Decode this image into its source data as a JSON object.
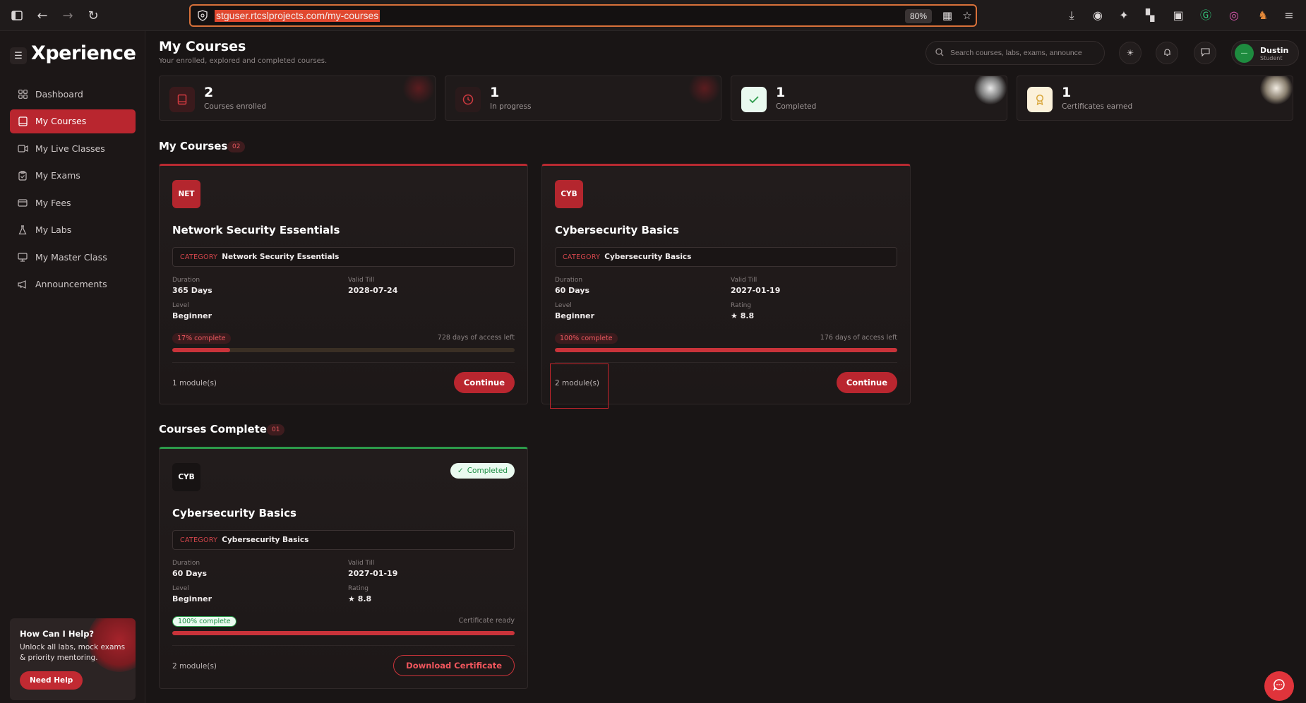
{
  "browser": {
    "url": "stguser.rtcslprojects.com/my-courses",
    "zoom": "80%"
  },
  "sidebar": {
    "logo": "Xperience",
    "items": [
      {
        "label": "Dashboard",
        "icon": "grid-icon"
      },
      {
        "label": "My Courses",
        "icon": "book-icon",
        "active": true
      },
      {
        "label": "My Live Classes",
        "icon": "video-icon"
      },
      {
        "label": "My Exams",
        "icon": "clipboard-icon"
      },
      {
        "label": "My Fees",
        "icon": "card-icon"
      },
      {
        "label": "My Labs",
        "icon": "flask-icon"
      },
      {
        "label": "My Master Class",
        "icon": "monitor-icon"
      },
      {
        "label": "Announcements",
        "icon": "megaphone-icon"
      }
    ],
    "help": {
      "title": "How Can I Help?",
      "desc": "Unlock all labs, mock exams & priority mentoring.",
      "button": "Need Help"
    }
  },
  "header": {
    "title": "My Courses",
    "subtitle": "Your enrolled, explored and completed courses.",
    "search_placeholder": "Search courses, labs, exams, announce",
    "user": {
      "name": "Dustin",
      "role": "Student",
      "initials": "—"
    }
  },
  "stats": [
    {
      "value": "2",
      "label": "Courses enrolled",
      "icon": "book-icon",
      "color": "#d13a40"
    },
    {
      "value": "1",
      "label": "In progress",
      "icon": "clock-icon",
      "color": "#d13a40"
    },
    {
      "value": "1",
      "label": "Completed",
      "icon": "check-icon",
      "color": "#2c9a4a"
    },
    {
      "value": "1",
      "label": "Certificates earned",
      "icon": "award-icon",
      "color": "#d8a63a"
    }
  ],
  "my_courses": {
    "title": "My Courses",
    "count": "02",
    "items": [
      {
        "code": "NET",
        "title": "Network Security Essentials",
        "category_key": "CATEGORY",
        "category": "Network Security Essentials",
        "duration_label": "Duration",
        "duration": "365 Days",
        "valid_label": "Valid Till",
        "valid": "2028-07-24",
        "level_label": "Level",
        "level": "Beginner",
        "progress_label": "17% complete",
        "progress": 17,
        "remaining": "728 days of access left",
        "modules": "1 module(s)",
        "action": "Continue"
      },
      {
        "code": "CYB",
        "title": "Cybersecurity Basics",
        "category_key": "CATEGORY",
        "category": "Cybersecurity Basics",
        "duration_label": "Duration",
        "duration": "60 Days",
        "valid_label": "Valid Till",
        "valid": "2027-01-19",
        "level_label": "Level",
        "level": "Beginner",
        "rating_label": "Rating",
        "rating": "★ 8.8",
        "progress_label": "100% complete",
        "progress": 100,
        "remaining": "176 days of access left",
        "modules": "2 module(s)",
        "action": "Continue"
      }
    ]
  },
  "completed": {
    "title": "Courses Completed",
    "count": "01",
    "items": [
      {
        "code": "CYB",
        "status": "Completed",
        "title": "Cybersecurity Basics",
        "category_key": "CATEGORY",
        "category": "Cybersecurity Basics",
        "duration_label": "Duration",
        "duration": "60 Days",
        "valid_label": "Valid Till",
        "valid": "2027-01-19",
        "level_label": "Level",
        "level": "Beginner",
        "rating_label": "Rating",
        "rating": "★ 8.8",
        "progress_label": "100% complete",
        "progress": 100,
        "remaining": "Certificate ready",
        "modules": "2 module(s)",
        "action": "Download Certificate"
      }
    ]
  }
}
